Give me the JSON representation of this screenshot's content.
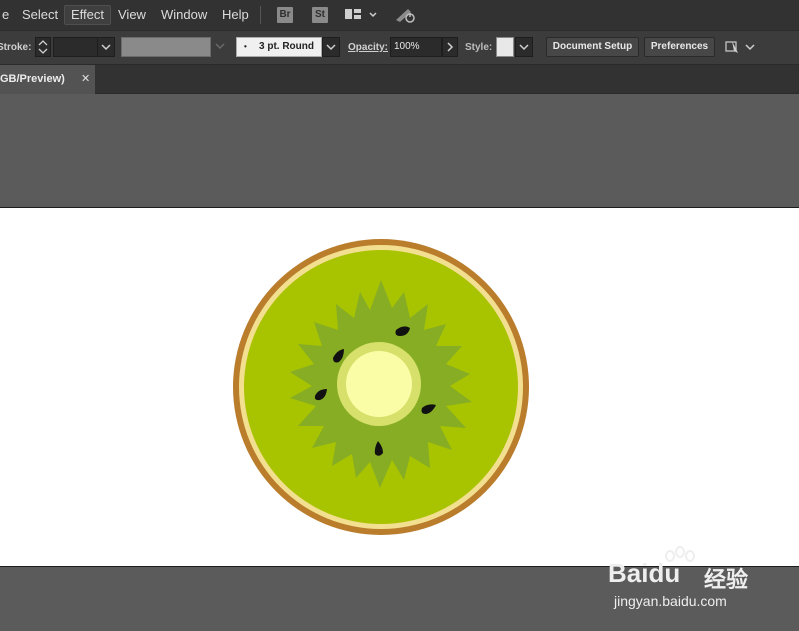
{
  "menu": {
    "items": [
      "e",
      "Select",
      "Effect",
      "View",
      "Window",
      "Help"
    ],
    "bridge_badge": "Br",
    "stock_badge": "St"
  },
  "controlbar": {
    "stroke_label": "Stroke:",
    "brush_value": "3 pt. Round",
    "opacity_label": "Opacity:",
    "opacity_value": "100%",
    "style_label": "Style:",
    "document_setup": "Document Setup",
    "preferences": "Preferences"
  },
  "tab": {
    "label": "GB/Preview)",
    "close": "✕"
  },
  "watermark": {
    "brand": "Bai",
    "brand2": "du",
    "cn": "经验",
    "url": "jingyan.baidu.com"
  },
  "colors": {
    "skin": "#b97d2c",
    "rim": "#f3df90",
    "flesh": "#a8c400",
    "inner": "#86ad24",
    "core_ring": "#d6e06a",
    "core": "#fbfda6",
    "seed": "#111111"
  }
}
